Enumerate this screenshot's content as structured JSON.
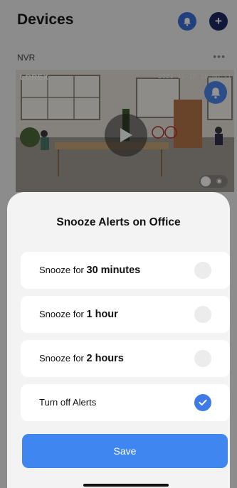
{
  "header": {
    "title": "Devices",
    "bell_icon": "bell-icon",
    "add_label": "+"
  },
  "nvr": {
    "label": "NVR",
    "more": "•••"
  },
  "camera": {
    "logo": "LOREX",
    "timestamp": "2021-11-15 16:08:17",
    "bell_icon": "bell-icon",
    "play_icon": "play-icon",
    "toggle_icon": "eye-icon",
    "toggle_eye": "◉"
  },
  "sheet": {
    "title": "Snooze Alerts on Office",
    "options": [
      {
        "prefix": "Snooze for ",
        "emphasis": "30 minutes",
        "selected": false
      },
      {
        "prefix": "Snooze for ",
        "emphasis": "1 hour",
        "selected": false
      },
      {
        "prefix": "Snooze for ",
        "emphasis": "2 hours",
        "selected": false
      },
      {
        "prefix": "Turn off Alerts",
        "emphasis": "",
        "selected": true
      }
    ],
    "save_label": "Save"
  },
  "colors": {
    "accent": "#3f86f0",
    "check": "#3f7be6",
    "header_bell": "#3b6fd8",
    "add_button": "#1f2a63"
  }
}
